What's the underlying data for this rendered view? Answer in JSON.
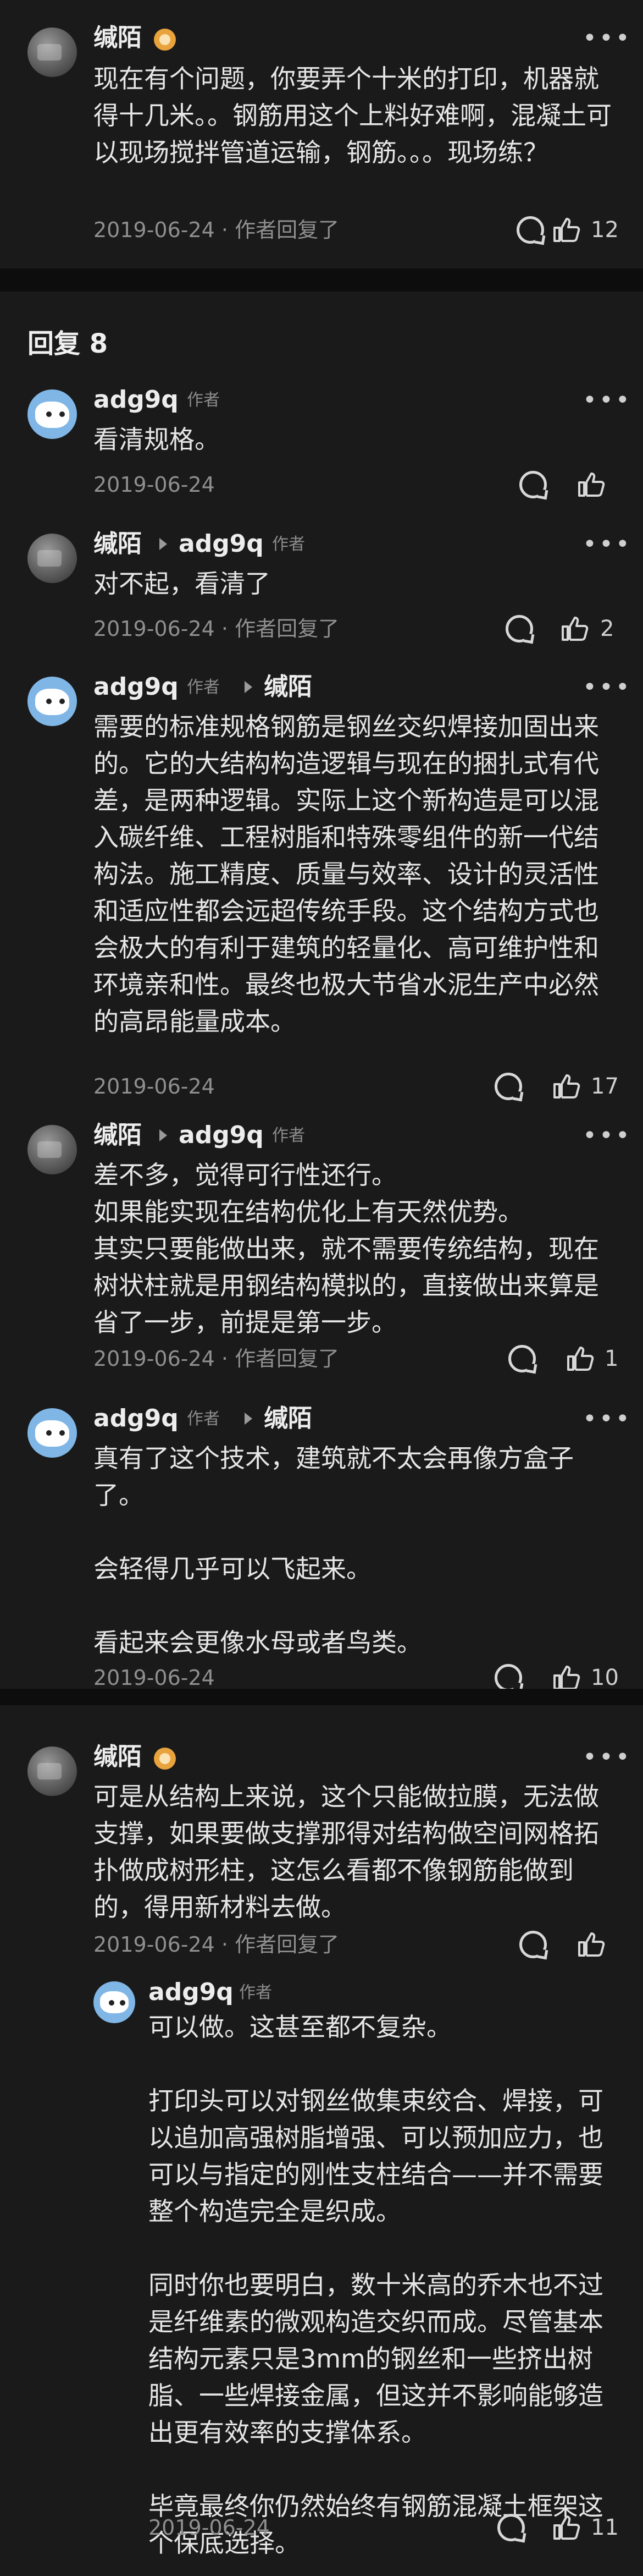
{
  "section": {
    "title": "回复 8"
  },
  "top_comment": {
    "user": "缄陌",
    "text": "现在有个问题，你要弄个十米的打印，机器就得十几米。。钢筋用这个上料好难啊，混凝土可以现场搅拌管道运输，钢筋。。。现场练？",
    "date": "2019-06-24",
    "author_replied": "作者回复了",
    "likes": "12"
  },
  "replies": [
    {
      "user": "adg9q",
      "tag": "作者",
      "to": "",
      "text": "看清规格。",
      "date": "2019-06-24",
      "author_replied": "",
      "likes": ""
    },
    {
      "user": "缄陌",
      "tag": "作者",
      "to": "adg9q",
      "text": "对不起，看清了",
      "date": "2019-06-24",
      "author_replied": "作者回复了",
      "likes": "2"
    },
    {
      "user": "adg9q",
      "tag": "作者",
      "to": "缄陌",
      "text": "需要的标准规格钢筋是钢丝交织焊接加固出来的。它的大结构构造逻辑与现在的捆扎式有代差，是两种逻辑。实际上这个新构造是可以混入碳纤维、工程树脂和特殊零组件的新一代结构法。施工精度、质量与效率、设计的灵活性和适应性都会远超传统手段。这个结构方式也会极大的有利于建筑的轻量化、高可维护性和环境亲和性。最终也极大节省水泥生产中必然的高昂能量成本。",
      "date": "2019-06-24",
      "author_replied": "",
      "likes": "17"
    },
    {
      "user": "缄陌",
      "tag": "作者",
      "to": "adg9q",
      "text": "差不多，觉得可行性还行。\n如果能实现在结构优化上有天然优势。\n其实只要能做出来，就不需要传统结构，现在树状柱就是用钢结构模拟的，直接做出来算是省了一步，前提是第一步。",
      "date": "2019-06-24",
      "author_replied": "作者回复了",
      "likes": "1"
    },
    {
      "user": "adg9q",
      "tag": "作者",
      "to": "缄陌",
      "text": "真有了这个技术，建筑就不太会再像方盒子了。\n\n会轻得几乎可以飞起来。\n\n看起来会更像水母或者鸟类。",
      "date": "2019-06-24",
      "author_replied": "",
      "likes": "10"
    }
  ],
  "thread": {
    "user": "缄陌",
    "text": "可是从结构上来说，这个只能做拉膜，无法做支撑，如果要做支撑那得对结构做空间网格拓扑做成树形柱，这怎么看都不像钢筋能做到的，得用新材料去做。",
    "date": "2019-06-24",
    "author_replied": "作者回复了",
    "likes": "",
    "sub_reply": {
      "user": "adg9q",
      "tag": "作者",
      "text": "可以做。这甚至都不复杂。\n\n打印头可以对钢丝做集束绞合、焊接，可以追加高强树脂增强、可以预加应力，也可以与指定的刚性支柱结合——并不需要整个构造完全是织成。\n\n同时你也要明白，数十米高的乔木也不过是纤维素的微观构造交织而成。尽管基本结构元素只是3mm的钢丝和一些挤出树脂、一些焊接金属，但这并不影响能够造出更有效率的支撑体系。\n\n毕竟最终你仍然始终有钢筋混凝土框架这个保底选择。",
      "date": "2019-06-24",
      "likes": "11"
    }
  },
  "icons": {
    "more": "more-dots-icon",
    "reply": "reply-bubble-icon",
    "like": "thumbs-up-icon",
    "arrow": "reply-to-arrow-icon",
    "badge": "user-badge-icon"
  },
  "colors": {
    "background": "#121212",
    "card": "#1a1a1a",
    "text": "#e6e6e6",
    "meta": "#8f8f8f"
  }
}
